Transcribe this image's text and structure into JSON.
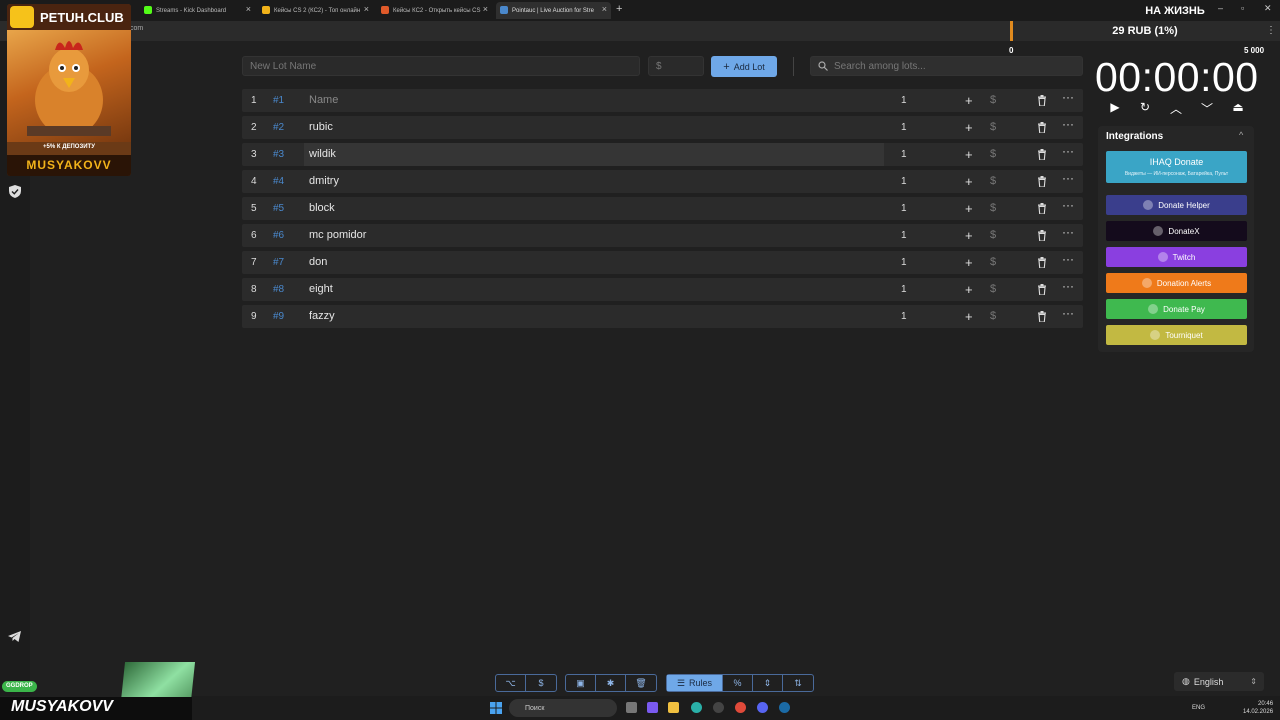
{
  "tabs": [
    {
      "label": "Streams - Kick Dashboard",
      "color": "#53fc18"
    },
    {
      "label": "Кейсы CS 2 (КС2) - Топ онлайн",
      "color": "#f2b31a"
    },
    {
      "label": "Кейсы КС2 - Открыть кейсы CS",
      "color": "#e05a2a"
    },
    {
      "label": "Pointauc | Live Auction for Stre",
      "color": "#4a88cc"
    }
  ],
  "url_fragment": "com",
  "promo": {
    "title": "PETUH.CLUB",
    "bonus": "+5% К ДЕПОЗИТУ",
    "brand": "MUSYAKOVV"
  },
  "reason": "НА ЖИЗНЬ",
  "price": "29 RUB (1%)",
  "scale": {
    "min": "0",
    "max": "5 000",
    "progress_percent": 0
  },
  "timer": "00:00:00",
  "input": {
    "lot_name_placeholder": "New Lot Name",
    "amount_placeholder": "$",
    "add_label": "Add Lot",
    "search_placeholder": "Search among lots..."
  },
  "lots": [
    {
      "idx": "1",
      "id": "#1",
      "name": "Name",
      "amount": "1",
      "placeholder": true
    },
    {
      "idx": "2",
      "id": "#2",
      "name": "rubic",
      "amount": "1"
    },
    {
      "idx": "3",
      "id": "#3",
      "name": "wildik",
      "amount": "1",
      "highlight": true
    },
    {
      "idx": "4",
      "id": "#4",
      "name": "dmitry",
      "amount": "1"
    },
    {
      "idx": "5",
      "id": "#5",
      "name": "block",
      "amount": "1"
    },
    {
      "idx": "6",
      "id": "#6",
      "name": "mc pomidor",
      "amount": "1"
    },
    {
      "idx": "7",
      "id": "#7",
      "name": "don",
      "amount": "1"
    },
    {
      "idx": "8",
      "id": "#8",
      "name": "eight",
      "amount": "1"
    },
    {
      "idx": "9",
      "id": "#9",
      "name": "fazzy",
      "amount": "1"
    }
  ],
  "integrations": {
    "title": "Integrations",
    "ihaq": {
      "label": "IHAQ Donate",
      "sub": "Виджеты — ИИ-персонаж, Батарейка, Пульт"
    },
    "buttons": [
      {
        "label": "Donate Helper",
        "bg": "#3a3e8c"
      },
      {
        "label": "DonateX",
        "bg": "#140b1c"
      },
      {
        "label": "Twitch",
        "bg": "#8a3fe0"
      },
      {
        "label": "Donation Alerts",
        "bg": "#ef7a1a"
      },
      {
        "label": "Donate Pay",
        "bg": "#3fb94f"
      },
      {
        "label": "Tourniquet",
        "bg": "#c2b942"
      }
    ]
  },
  "toolbar": {
    "rules_label": "Rules"
  },
  "language": "English",
  "overlay": {
    "ggdrop": "GGDROP",
    "brand": "MUSYAKOVV"
  },
  "taskbar": {
    "search": "Поиск",
    "lang": "ENG",
    "time": "20:46",
    "date": "14.02.2026"
  },
  "colors": {
    "accent": "#6fa8e8",
    "id_blue": "#4a88cc",
    "orange": "#e08a1e"
  }
}
